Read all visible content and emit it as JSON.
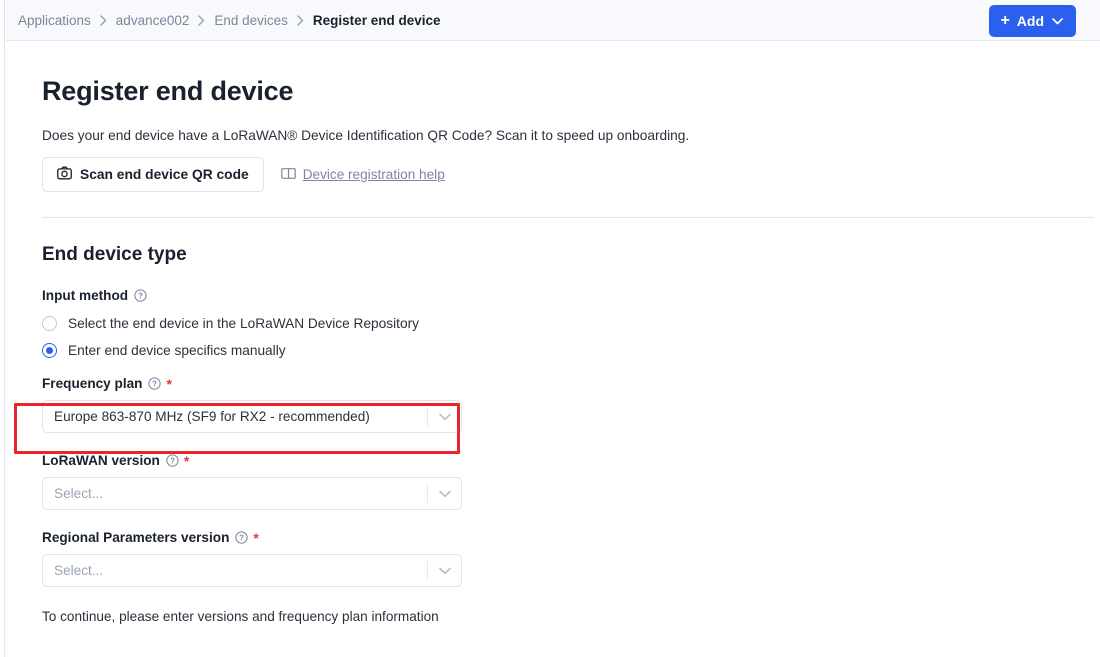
{
  "breadcrumb": {
    "items": [
      {
        "label": "Applications",
        "current": false
      },
      {
        "label": "advance002",
        "current": false
      },
      {
        "label": "End devices",
        "current": false
      },
      {
        "label": "Register end device",
        "current": true
      }
    ]
  },
  "topbar": {
    "add_button": {
      "label": "Add",
      "plus": "+",
      "icon": "chevron-down-icon",
      "color": "#2b5fee"
    }
  },
  "page": {
    "title": "Register end device",
    "intro": "Does your end device have a LoRaWAN® Device Identification QR Code? Scan it to speed up onboarding.",
    "qr_button_label": "Scan end device QR code",
    "qr_button_icon": "camera-icon",
    "help_link_label": "Device registration help",
    "help_link_icon": "book-icon"
  },
  "end_device_type": {
    "section_title": "End device type",
    "input_method": {
      "label": "Input method",
      "help_icon": "question-circle-icon",
      "options": [
        {
          "label": "Select the end device in the LoRaWAN Device Repository",
          "selected": false
        },
        {
          "label": "Enter end device specifics manually",
          "selected": true
        }
      ]
    },
    "fields": [
      {
        "name": "frequency-plan",
        "label": "Frequency plan",
        "required": "*",
        "help_icon": "question-circle-icon",
        "value": "Europe 863-870 MHz (SF9 for RX2 - recommended)",
        "is_placeholder": false,
        "highlighted": true
      },
      {
        "name": "lorawan-version",
        "label": "LoRaWAN version",
        "required": "*",
        "help_icon": "question-circle-icon",
        "value": "Select...",
        "is_placeholder": true,
        "highlighted": false
      },
      {
        "name": "regional-parameters-version",
        "label": "Regional Parameters version",
        "required": "*",
        "help_icon": "question-circle-icon",
        "value": "Select...",
        "is_placeholder": true,
        "highlighted": false
      }
    ],
    "footnote": "To continue, please enter versions and frequency plan information"
  },
  "annotation": {
    "type": "highlight-rectangle",
    "color": "#e8252a",
    "target": "frequency-plan"
  }
}
